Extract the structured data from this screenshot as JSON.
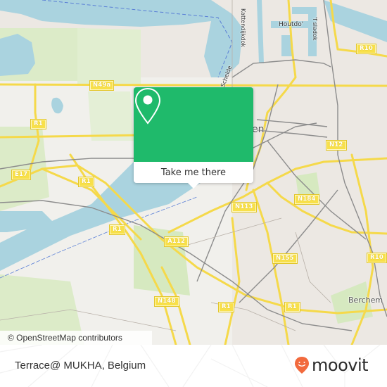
{
  "map": {
    "attribution": "© OpenStreetMap contributors",
    "colors": {
      "water": "#aad3df",
      "land": "#ece8e3",
      "park": "#d8ebc4",
      "industrial": "#f1eeea",
      "road_major": "#f8e04a",
      "rail": "#888888",
      "accent_green": "#1fba6b",
      "moovit_orange": "#f26a3d"
    },
    "road_shields": [
      {
        "id": "n49a",
        "label": "N49a"
      },
      {
        "id": "r1-nw",
        "label": "R1"
      },
      {
        "id": "e17",
        "label": "E17"
      },
      {
        "id": "r1-w",
        "label": "R1"
      },
      {
        "id": "r1-sw",
        "label": "R1"
      },
      {
        "id": "a112",
        "label": "A112"
      },
      {
        "id": "n113",
        "label": "N113"
      },
      {
        "id": "n148",
        "label": "N148"
      },
      {
        "id": "r1-s",
        "label": "R1"
      },
      {
        "id": "r1-se",
        "label": "R1"
      },
      {
        "id": "n12",
        "label": "N12"
      },
      {
        "id": "n184",
        "label": "N184"
      },
      {
        "id": "n155",
        "label": "N155"
      },
      {
        "id": "r10-ne",
        "label": "R10"
      },
      {
        "id": "r10-e",
        "label": "R10"
      }
    ],
    "place_labels": {
      "city_fragment": "en",
      "berchem": "Berchem",
      "houtdok": "Houtdo'",
      "kattendijkdok": "Kattendijkdok",
      "ijzerlaandok": "'f sladok",
      "schelde": "Schelde"
    }
  },
  "popup": {
    "icon": "map-pin-icon",
    "button_label": "Take me there"
  },
  "footer": {
    "place_name": "Terrace@ MUKHA, Belgium",
    "brand": "moovit",
    "brand_icon": "moovit-smile-pin-icon"
  }
}
